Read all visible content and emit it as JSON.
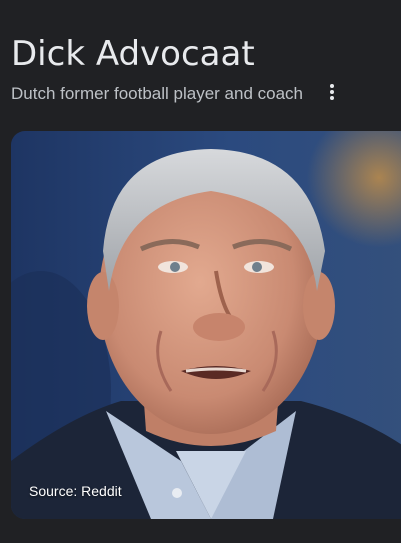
{
  "entity": {
    "title": "Dick Advocaat",
    "description": "Dutch former football player and coach"
  },
  "image": {
    "source_caption": "Source: Reddit"
  },
  "icons": {
    "more": "more-vert-icon"
  },
  "colors": {
    "background": "#202124",
    "title_text": "#e8eaed",
    "subtitle_text": "#bdc1c6"
  }
}
